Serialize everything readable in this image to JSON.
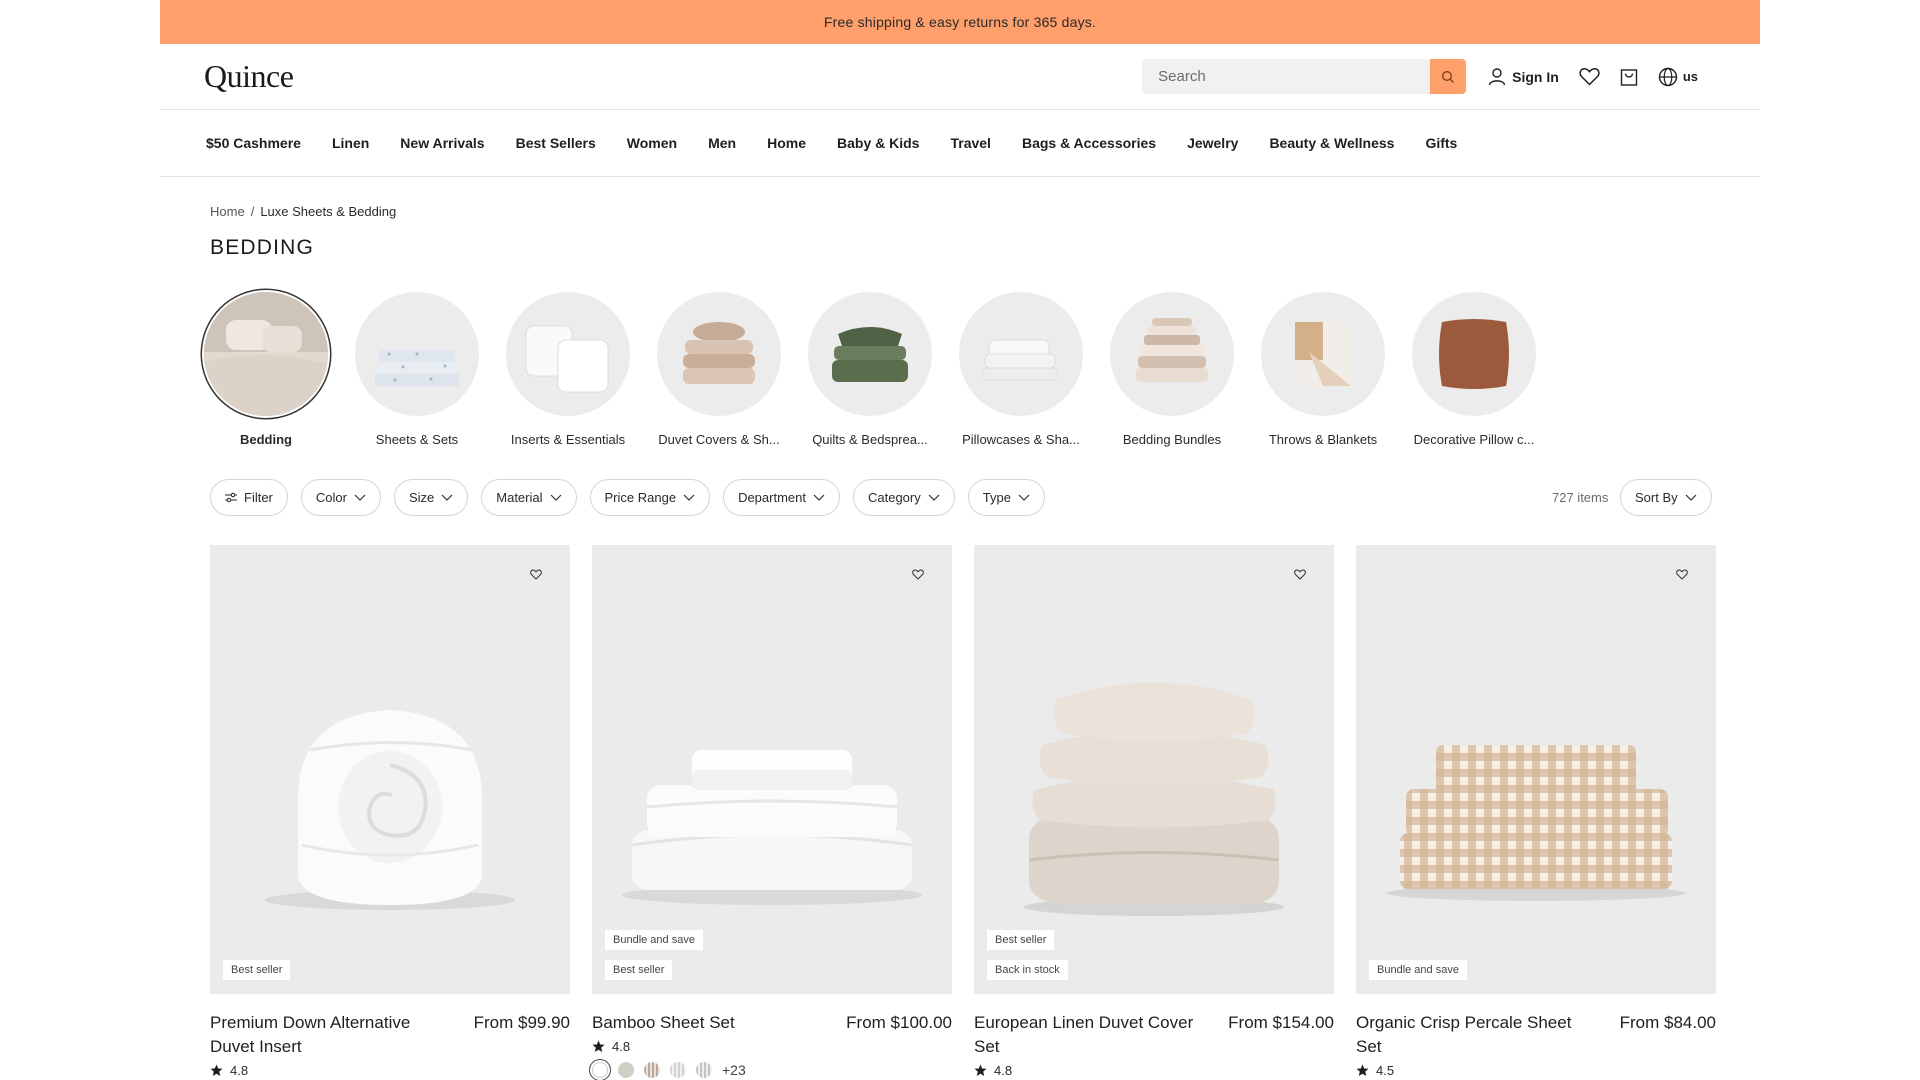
{
  "promo": {
    "text": "Free shipping & easy returns for 365 days."
  },
  "header": {
    "logo": "Quince",
    "search_placeholder": "Search",
    "sign_in": "Sign In",
    "locale": "us"
  },
  "nav": {
    "items": [
      "$50 Cashmere",
      "Linen",
      "New Arrivals",
      "Best Sellers",
      "Women",
      "Men",
      "Home",
      "Baby & Kids",
      "Travel",
      "Bags & Accessories",
      "Jewelry",
      "Beauty & Wellness",
      "Gifts"
    ]
  },
  "breadcrumb": {
    "home": "Home",
    "separator": "/",
    "current": "Luxe Sheets & Bedding"
  },
  "page_title": "BEDDING",
  "categories": [
    {
      "label": "Bedding",
      "active": true
    },
    {
      "label": "Sheets & Sets"
    },
    {
      "label": "Inserts & Essentials"
    },
    {
      "label": "Duvet Covers & Sh..."
    },
    {
      "label": "Quilts & Bedsprea..."
    },
    {
      "label": "Pillowcases & Sha..."
    },
    {
      "label": "Bedding Bundles"
    },
    {
      "label": "Throws & Blankets"
    },
    {
      "label": "Decorative Pillow c..."
    }
  ],
  "filters": {
    "filter": "Filter",
    "pills": [
      "Color",
      "Size",
      "Material",
      "Price Range",
      "Department",
      "Category",
      "Type"
    ],
    "items_count": "727 items",
    "sort_by": "Sort By"
  },
  "products": [
    {
      "name": "Premium Down Alternative Duvet Insert",
      "price": "From $99.90",
      "rating": "4.8",
      "badges": [
        "Best seller"
      ]
    },
    {
      "name": "Bamboo Sheet Set",
      "price": "From $100.00",
      "rating": "4.8",
      "badges": [
        "Bundle and save",
        "Best seller"
      ],
      "swatch_more": "+23"
    },
    {
      "name": "European Linen Duvet Cover Set",
      "price": "From $154.00",
      "rating": "4.8",
      "badges": [
        "Best seller",
        "Back in stock"
      ]
    },
    {
      "name": "Organic Crisp Percale Sheet Set",
      "price": "From $84.00",
      "rating": "4.5",
      "badges": [
        "Bundle and save"
      ]
    }
  ],
  "colors": {
    "promo_bg": "#ff9f6b",
    "search_button": "#ff9f6b"
  }
}
